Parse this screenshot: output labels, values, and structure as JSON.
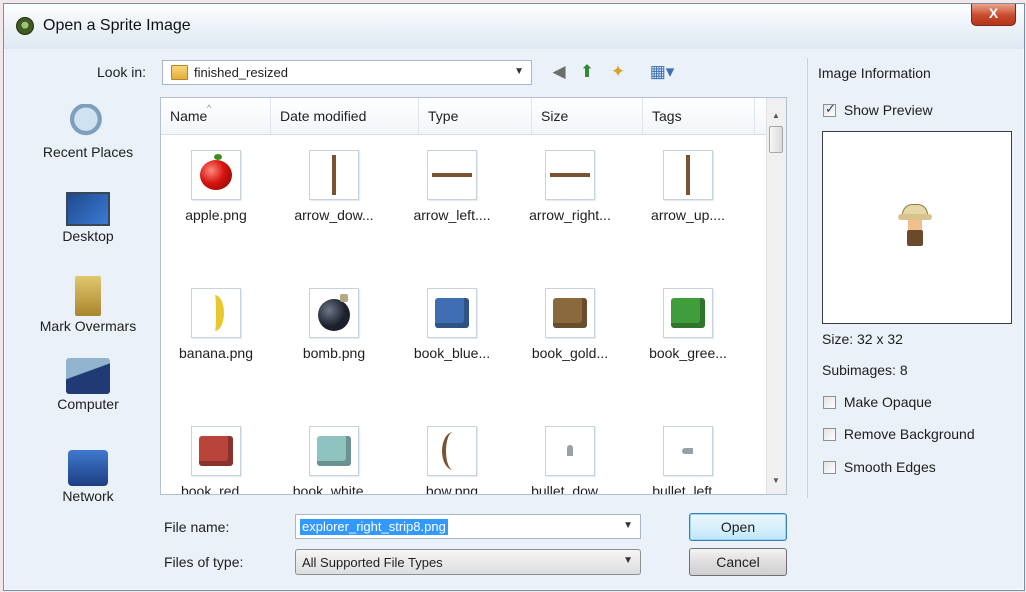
{
  "window": {
    "title": "Open a Sprite Image",
    "close_label": "X"
  },
  "toolbar": {
    "look_in_label": "Look in:",
    "look_in_value": "finished_resized",
    "icons": [
      "back-icon",
      "up-folder-icon",
      "new-folder-icon",
      "view-menu-icon"
    ]
  },
  "places": [
    {
      "label": "Recent Places",
      "icon": "recent-places-icon"
    },
    {
      "label": "Desktop",
      "icon": "desktop-icon"
    },
    {
      "label": "Mark Overmars",
      "icon": "user-folder-icon"
    },
    {
      "label": "Computer",
      "icon": "computer-icon"
    },
    {
      "label": "Network",
      "icon": "network-icon"
    }
  ],
  "columns": [
    "Name",
    "Date modified",
    "Type",
    "Size",
    "Tags"
  ],
  "files": [
    {
      "label": "apple.png",
      "icon": "apple"
    },
    {
      "label": "arrow_dow...",
      "icon": "arrow-down"
    },
    {
      "label": "arrow_left....",
      "icon": "arrow-left"
    },
    {
      "label": "arrow_right...",
      "icon": "arrow-right"
    },
    {
      "label": "arrow_up....",
      "icon": "arrow-up"
    },
    {
      "label": "banana.png",
      "icon": "banana"
    },
    {
      "label": "bomb.png",
      "icon": "bomb"
    },
    {
      "label": "book_blue...",
      "icon": "book-blue"
    },
    {
      "label": "book_gold...",
      "icon": "book-gold"
    },
    {
      "label": "book_gree...",
      "icon": "book-green"
    },
    {
      "label": "book_red...",
      "icon": "book-red"
    },
    {
      "label": "book_white...",
      "icon": "book-white"
    },
    {
      "label": "bow.png",
      "icon": "bow"
    },
    {
      "label": "bullet_dow...",
      "icon": "bullet-down"
    },
    {
      "label": "bullet_left...",
      "icon": "bullet-left"
    }
  ],
  "colors": {
    "book_blue": "#3f6fb2",
    "book_gold": "#8a6a3c",
    "book_green": "#3f9d3b",
    "book_red": "#b8443c",
    "book_white": "#8fc3c0",
    "selection": "#3399ff"
  },
  "form": {
    "file_name_label": "File name:",
    "file_name_value": "explorer_right_strip8.png",
    "file_type_label": "Files of type:",
    "file_type_value": "All Supported File Types",
    "open_label": "Open",
    "cancel_label": "Cancel"
  },
  "info": {
    "title": "Image Information",
    "show_preview_label": "Show Preview",
    "show_preview_checked": true,
    "size_text": "Size: 32 x 32",
    "subimages_text": "Subimages: 8",
    "make_opaque_label": "Make Opaque",
    "remove_background_label": "Remove Background",
    "smooth_edges_label": "Smooth Edges"
  }
}
